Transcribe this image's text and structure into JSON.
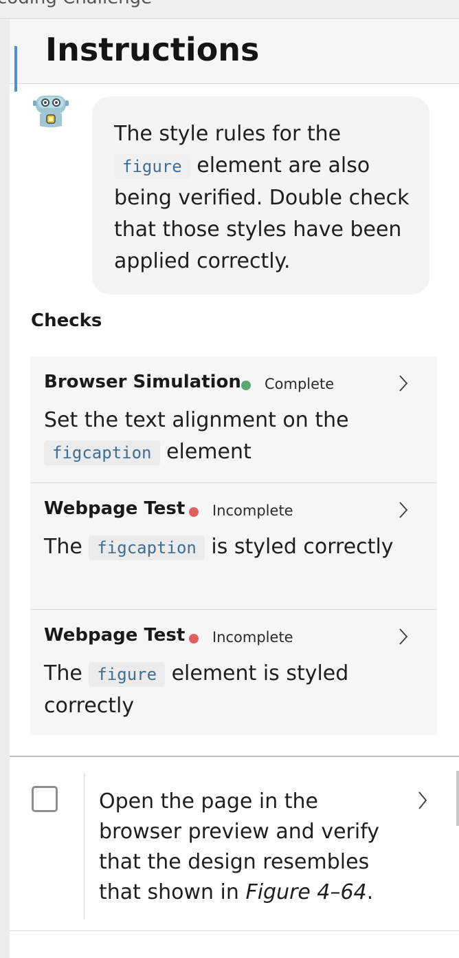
{
  "top_partial_text": "coding Challenge",
  "header": {
    "title": "Instructions"
  },
  "assistant": {
    "avatar_icon": "robot-icon",
    "message_parts": [
      "The style rules for the ",
      "figure",
      " element are also being verified. Double check that those styles have been applied correctly."
    ]
  },
  "checks": {
    "title": "Checks",
    "items": [
      {
        "type": "Browser Simulation",
        "status": "Complete",
        "status_color": "#5aa86e",
        "desc_before": "Set the text alignment on the ",
        "desc_code": "figcaption",
        "desc_after": " element"
      },
      {
        "type": "Webpage Test",
        "status": "Incomplete",
        "status_color": "#e06060",
        "desc_before": "The ",
        "desc_code": "figcaption",
        "desc_after": " is styled correctly"
      },
      {
        "type": "Webpage Test",
        "status": "Incomplete",
        "status_color": "#e06060",
        "desc_before": "The ",
        "desc_code": "figure",
        "desc_after": " element is styled correctly"
      }
    ]
  },
  "task": {
    "checked": false,
    "text_before": "Open the page in the browser preview and verify that the design resembles that shown in ",
    "text_em": "Figure 4–64",
    "text_after": "."
  }
}
